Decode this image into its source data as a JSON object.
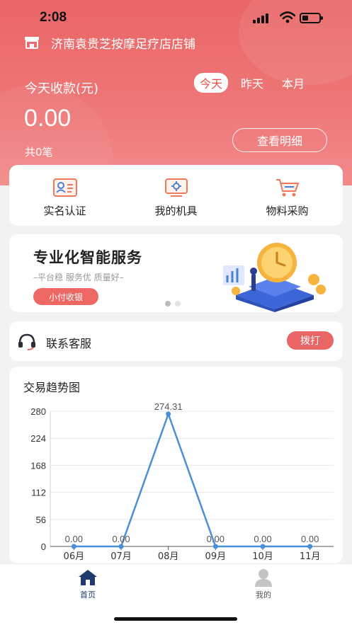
{
  "status_bar": {
    "time": "2:08"
  },
  "header": {
    "shop_name": "济南袁贵芝按摩足疗店店铺",
    "receipt_title": "今天收款(元)",
    "period_tabs": [
      "今天",
      "昨天",
      "本月"
    ],
    "active_period": "今天",
    "amount": "0.00",
    "count": "共0笔",
    "detail_button": "查看明细"
  },
  "quick_actions": [
    {
      "label": "实名认证",
      "icon": "id-card-icon"
    },
    {
      "label": "我的机具",
      "icon": "pos-terminal-icon"
    },
    {
      "label": "物料采购",
      "icon": "shopping-cart-icon"
    }
  ],
  "banner": {
    "title": "专业化智能服务",
    "subtitle": "–平台稳  服务优  质量好–",
    "button": "小付收银",
    "slides": 2,
    "active_slide": 0
  },
  "service": {
    "label": "联系客服",
    "call_button": "拨打"
  },
  "chart_data": {
    "type": "line",
    "title": "交易趋势图",
    "categories": [
      "06月",
      "07月",
      "08月",
      "09月",
      "10月",
      "11月"
    ],
    "values": [
      0.0,
      0.0,
      274.31,
      0.0,
      0.0,
      0.0
    ],
    "value_labels": [
      "0.00",
      "0.00",
      "274.31",
      "0.00",
      "0.00",
      "0.00"
    ],
    "y_ticks": [
      "0",
      "56",
      "112",
      "168",
      "224",
      "280"
    ],
    "ylim": [
      0,
      280
    ],
    "grid": true,
    "line_color": "#4a90d9"
  },
  "bottom_nav": [
    {
      "label": "首页",
      "active": true
    },
    {
      "label": "我的",
      "active": false
    }
  ],
  "colors": {
    "brand": "#e96566",
    "accent_text": "#e5534f"
  }
}
